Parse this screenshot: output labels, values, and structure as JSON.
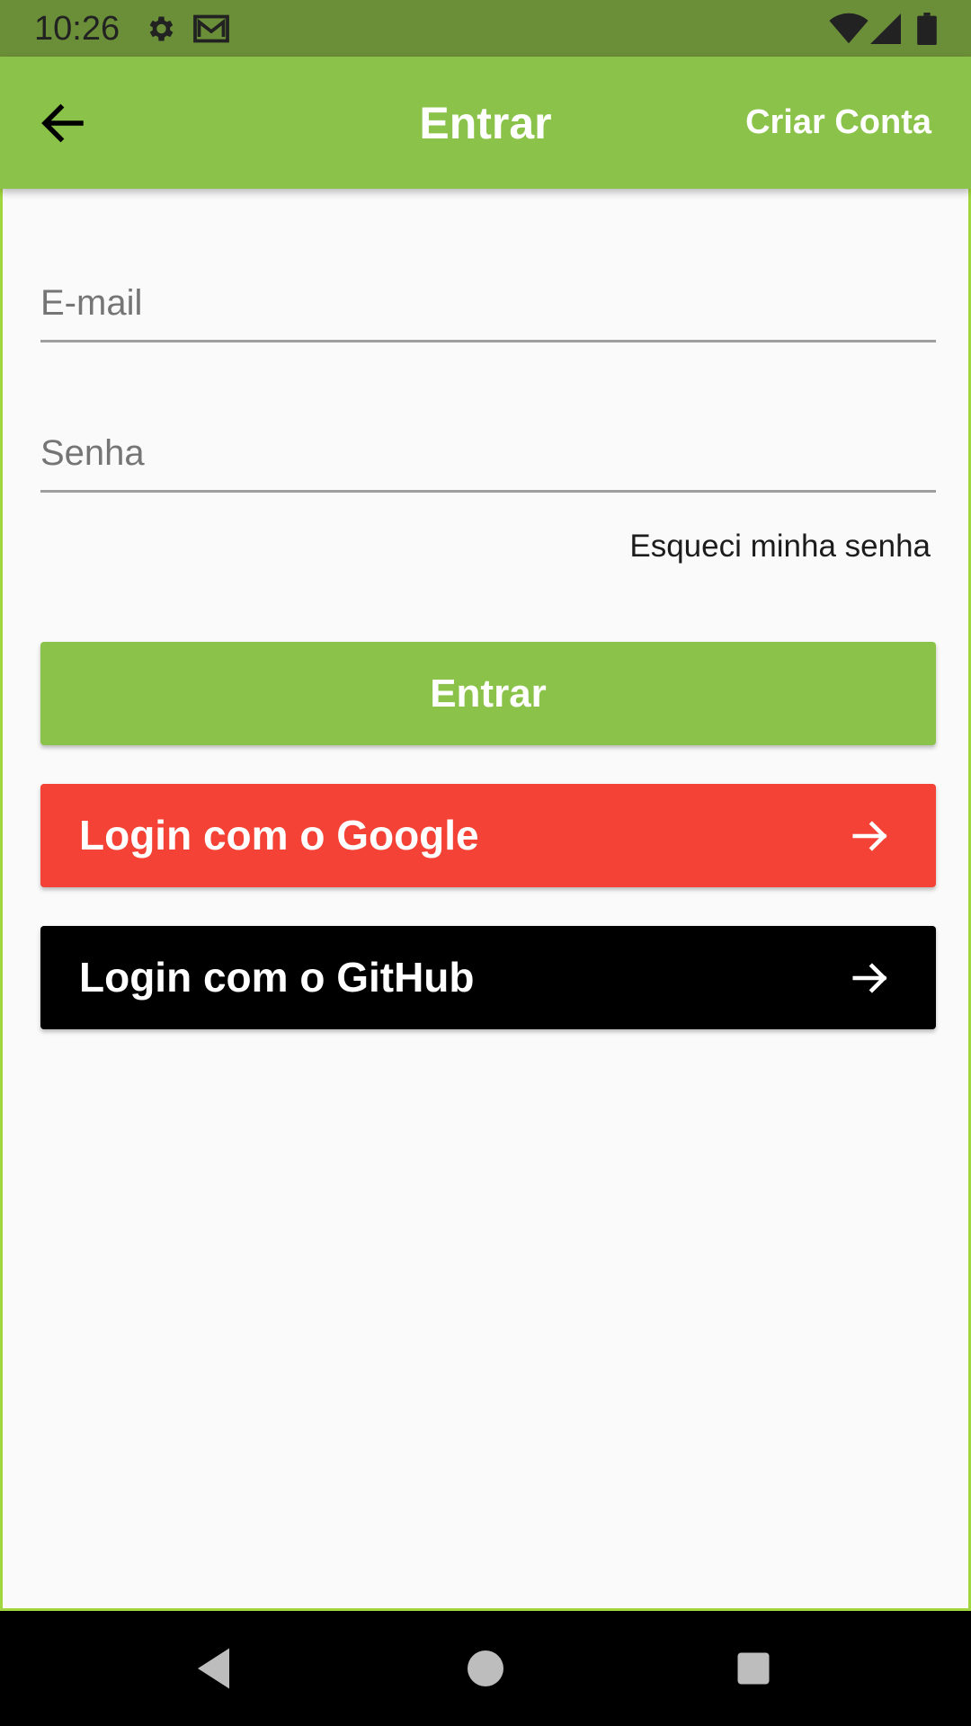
{
  "status_bar": {
    "time": "10:26",
    "icons": [
      "gear-icon",
      "gmail-icon",
      "wifi-icon",
      "signal-icon",
      "battery-icon"
    ]
  },
  "app_bar": {
    "title": "Entrar",
    "action_label": "Criar Conta",
    "back_icon": "arrow-left-icon",
    "color": "#8bc34a"
  },
  "form": {
    "email_placeholder": "E-mail",
    "email_value": "",
    "password_placeholder": "Senha",
    "password_value": "",
    "forgot_password_label": "Esqueci minha senha"
  },
  "buttons": {
    "login_label": "Entrar",
    "google_label": "Login com o Google",
    "github_label": "Login com o GitHub",
    "google_color": "#f44336",
    "github_color": "#000000",
    "arrow_icon": "arrow-right-icon"
  },
  "nav_bar": {
    "icons": [
      "back-triangle-icon",
      "home-circle-icon",
      "recents-square-icon"
    ]
  }
}
